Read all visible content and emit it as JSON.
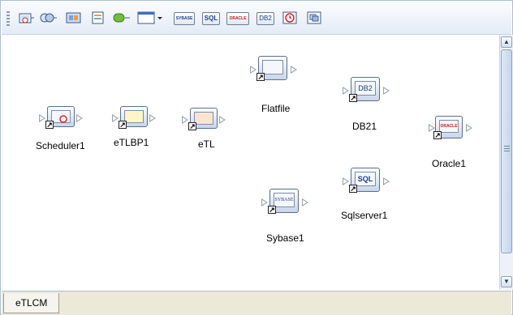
{
  "toolbar": {
    "items": [
      {
        "icon": "scheduler-icon"
      },
      {
        "icon": "business-process-icon"
      },
      {
        "icon": "etl-icon"
      },
      {
        "icon": "properties-icon"
      },
      {
        "icon": "connector-icon"
      },
      {
        "icon": "window-dropdown-icon"
      },
      {
        "icon": "sybase-icon",
        "text": "SYBASE"
      },
      {
        "icon": "sql-icon",
        "text": "SQL"
      },
      {
        "icon": "oracle-icon",
        "text": "ORACLE"
      },
      {
        "icon": "db2-icon",
        "text": "DB2"
      },
      {
        "icon": "clock-icon"
      },
      {
        "icon": "copy-icon"
      }
    ]
  },
  "nodes": {
    "scheduler1": {
      "label": "Scheduler1"
    },
    "etlbp1": {
      "label": "eTLBP1"
    },
    "etl": {
      "label": "eTL"
    },
    "flatfile": {
      "label": "Flatfile"
    },
    "db21": {
      "label": "DB21",
      "badge": "DB2"
    },
    "oracle1": {
      "label": "Oracle1",
      "badge": "ORACLE"
    },
    "sybase1": {
      "label": "Sybase1",
      "badge": "SYBASE"
    },
    "sqlserver1": {
      "label": "Sqlserver1",
      "badge": "SQL"
    }
  },
  "tabs": [
    {
      "label": "eTLCM"
    }
  ],
  "colors": {
    "accent": "#1b3f8a",
    "frame": "#a9bfd6"
  }
}
